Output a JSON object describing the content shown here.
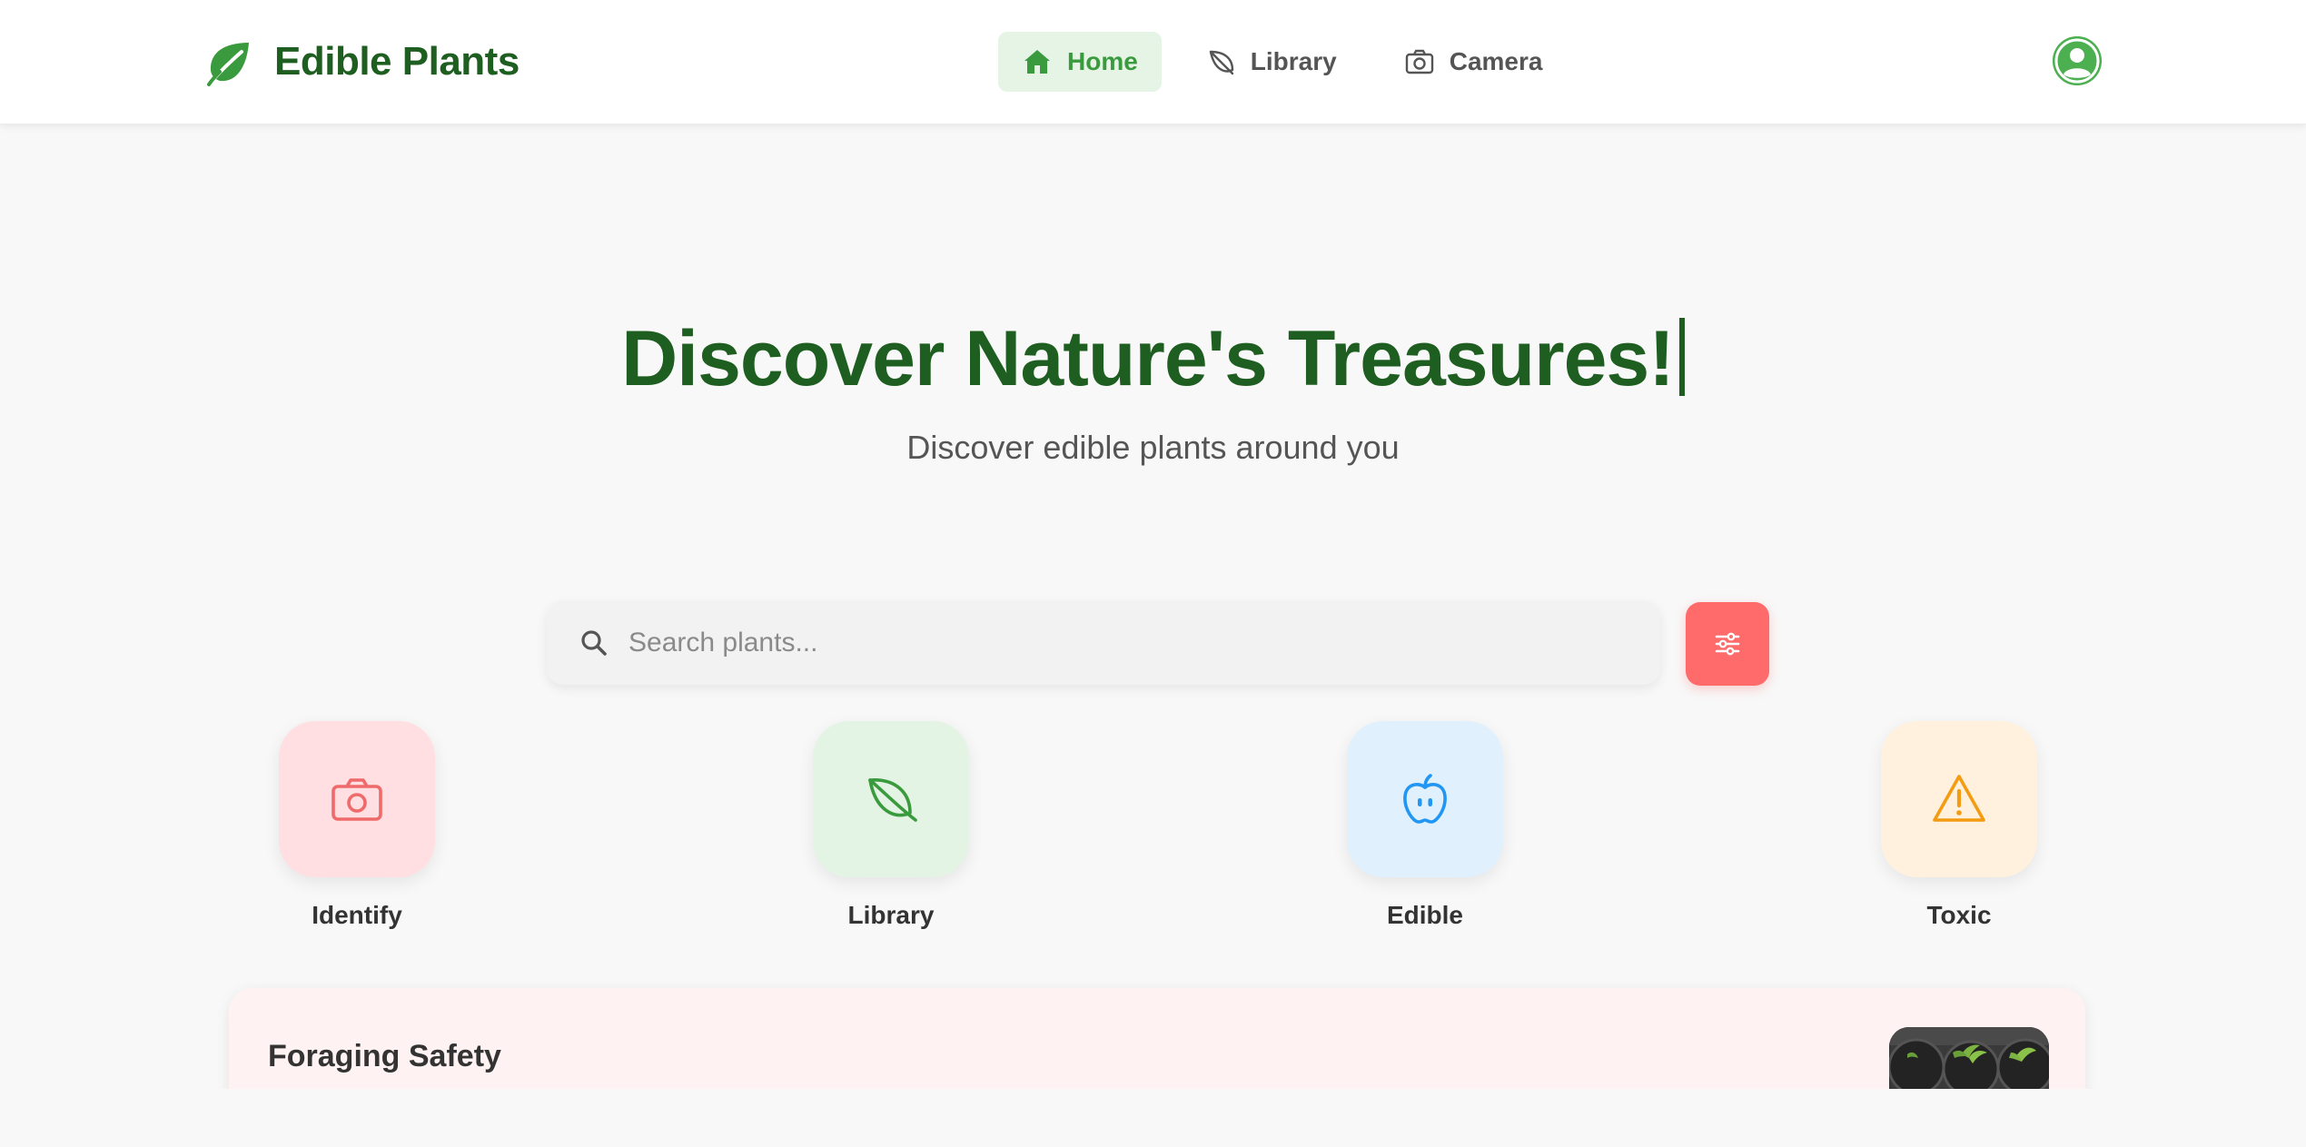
{
  "header": {
    "brand": {
      "name": "Edible Plants",
      "icon": "leaf-icon"
    },
    "nav": [
      {
        "label": "Home",
        "icon": "home-icon",
        "active": true
      },
      {
        "label": "Library",
        "icon": "leaf-outline-icon",
        "active": false
      },
      {
        "label": "Camera",
        "icon": "camera-icon",
        "active": false
      }
    ],
    "avatar_icon": "user-circle-icon"
  },
  "hero": {
    "title": "Discover Nature's Treasures!",
    "subtitle": "Discover edible plants around you"
  },
  "search": {
    "placeholder": "Search plants...",
    "value": "",
    "icon": "search-icon",
    "filter_icon": "sliders-icon"
  },
  "quick_actions": [
    {
      "label": "Identify",
      "icon": "camera-icon",
      "bg": "#ffdfe1",
      "color": "#ef6b6b"
    },
    {
      "label": "Library",
      "icon": "leaf-icon",
      "bg": "#e3f4e4",
      "color": "#3a9a3e"
    },
    {
      "label": "Edible",
      "icon": "apple-icon",
      "bg": "#e0f0fd",
      "color": "#2196f3"
    },
    {
      "label": "Toxic",
      "icon": "warning-icon",
      "bg": "#fff1de",
      "color": "#f39c12"
    }
  ],
  "safety_card": {
    "title": "Foraging Safety",
    "image": "seedlings-photo"
  },
  "colors": {
    "brand_green": "#1e5e20",
    "accent_green": "#4caf50",
    "accent_red": "#ff6b6b",
    "background": "#f8f8f8"
  }
}
